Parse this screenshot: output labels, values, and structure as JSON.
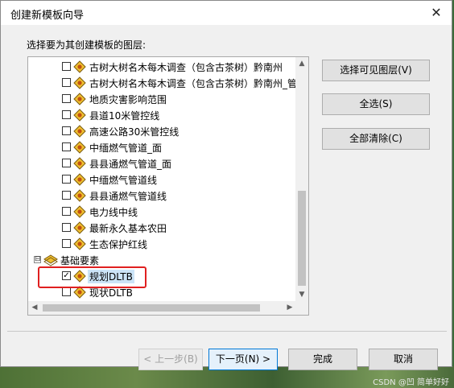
{
  "window": {
    "title": "创建新模板向导",
    "close_glyph": "✕"
  },
  "prompt": "选择要为其创建模板的图层:",
  "layers": [
    {
      "label": "古树大树名木每木调查（包含古茶树）黔南州",
      "checked": false
    },
    {
      "label": "古树大树名木每木调查（包含古茶树）黔南州_管:",
      "checked": false
    },
    {
      "label": "地质灾害影响范围",
      "checked": false
    },
    {
      "label": "县道10米管控线",
      "checked": false
    },
    {
      "label": "高速公路30米管控线",
      "checked": false
    },
    {
      "label": "中缅燃气管道_面",
      "checked": false
    },
    {
      "label": "县县通燃气管道_面",
      "checked": false
    },
    {
      "label": "中缅燃气管道线",
      "checked": false
    },
    {
      "label": "县县通燃气管道线",
      "checked": false
    },
    {
      "label": "电力线中线",
      "checked": false
    },
    {
      "label": "最新永久基本农田",
      "checked": false
    },
    {
      "label": "生态保护红线",
      "checked": false
    }
  ],
  "group": {
    "expander": "⊟",
    "label": "基础要素",
    "items": [
      {
        "label": "规划DLTB",
        "checked": true
      },
      {
        "label": "现状DLTB",
        "checked": false
      }
    ]
  },
  "check_glyph": "✓",
  "side_buttons": {
    "select_visible": "选择可见图层(V)",
    "select_all": "全选(S)",
    "clear_all": "全部清除(C)"
  },
  "nav_buttons": {
    "back": "< 上一步(B)",
    "next": "下一页(N) >",
    "finish": "完成",
    "cancel": "取消"
  },
  "scroll_glyphs": {
    "up": "▲",
    "down": "▼",
    "left": "◀",
    "right": "▶"
  },
  "watermark": "CSDN @凹    简单好好",
  "colors": {
    "highlight": "#e02020",
    "layer_icon_fill": "#f0c030",
    "layer_icon_dot": "#c05010",
    "selected_row": "#cce4f7"
  }
}
